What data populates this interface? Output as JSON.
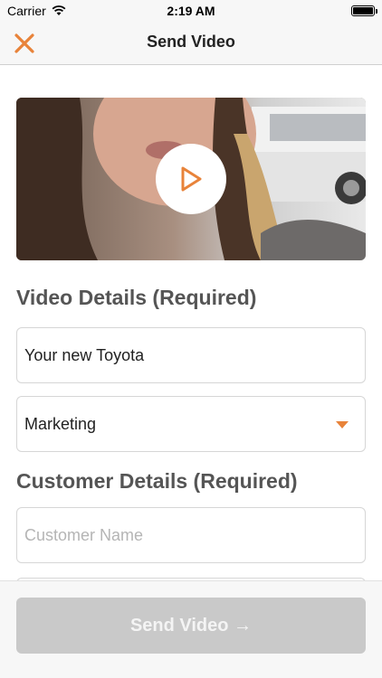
{
  "status_bar": {
    "carrier": "Carrier",
    "time": "2:19 AM"
  },
  "nav": {
    "title": "Send Video"
  },
  "video_details": {
    "heading": "Video Details (Required)",
    "title_value": "Your new Toyota",
    "category_value": "Marketing"
  },
  "customer_details": {
    "heading": "Customer Details (Required)",
    "name_placeholder": "Customer Name"
  },
  "send_button": {
    "label": "Send Video →"
  },
  "colors": {
    "accent": "#e8833a",
    "button_disabled": "#c9c9c9"
  }
}
